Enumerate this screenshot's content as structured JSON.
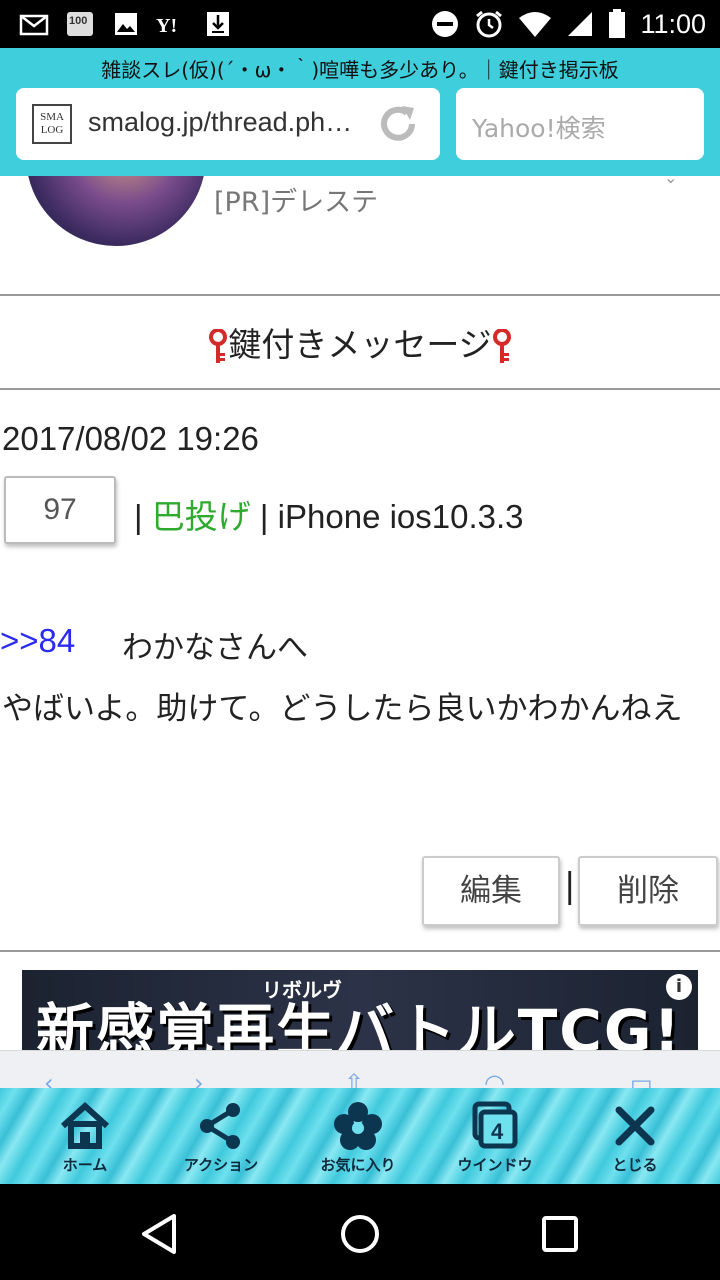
{
  "status_bar": {
    "time": "11:00",
    "icons": [
      "mail-icon",
      "app-icon",
      "image-icon",
      "yahoo-icon",
      "download-icon",
      "do-not-disturb-icon",
      "alarm-icon",
      "wifi-icon",
      "signal-icon",
      "battery-icon"
    ]
  },
  "browser": {
    "page_title": "雑談スレ(仮)(´・ω・｀)喧嘩も多少あり。｜鍵付き掲示板",
    "url": "smalog.jp/thread.ph…",
    "favicon_text": "SMA LOG",
    "search_placeholder": "Yahoo!検索"
  },
  "content": {
    "pr_text": "[PR]デレステ",
    "section_title": "鍵付きメッセージ",
    "post": {
      "date": "2017/08/02 19:26",
      "number": "97",
      "sep1": "|",
      "author": "巴投げ",
      "sep2": "|",
      "device": "iPhone ios10.3.3",
      "reply_link": ">>84",
      "reply_to": "わかなさんへ",
      "body": "やばいよ。助けて。どうしたら良いかわかんねえ"
    },
    "edit_label": "編集",
    "button_sep": "|",
    "delete_label": "削除",
    "ad": {
      "headline": "新感覚再生バトルTCG!",
      "ruby": "リボルヴ",
      "info": "i"
    }
  },
  "toolbar": {
    "items": [
      {
        "label": "ホーム",
        "icon": "home-icon"
      },
      {
        "label": "アクション",
        "icon": "share-icon"
      },
      {
        "label": "お気に入り",
        "icon": "flower-icon"
      },
      {
        "label": "ウインドウ",
        "icon": "window-icon",
        "count": "4"
      },
      {
        "label": "とじる",
        "icon": "close-icon"
      }
    ]
  },
  "colors": {
    "browser_bar": "#3fcfdc",
    "author_green": "#2eaa2e",
    "link_blue": "#2a2af0",
    "key_red": "#d42a2a"
  }
}
